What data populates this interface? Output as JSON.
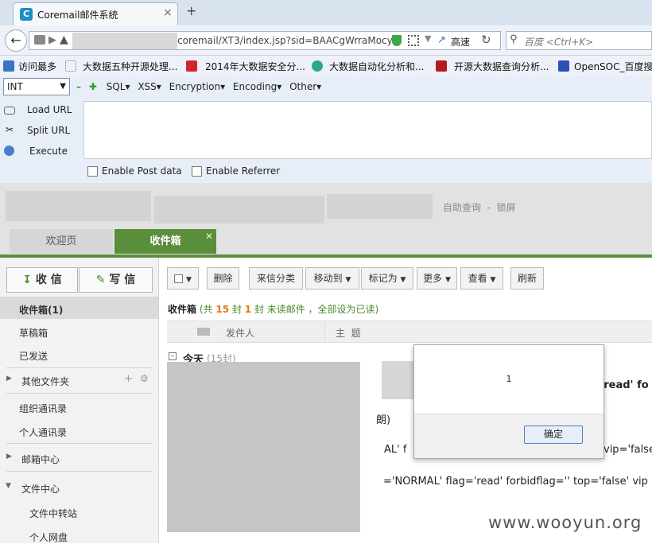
{
  "browser": {
    "tab_title": "Coremail邮件系统",
    "tab_icon_letter": "C",
    "url_visible": "coremail/XT3/index.jsp?sid=BAACgWrraMocy",
    "speed_label": "高速",
    "search_placeholder": "百度 <Ctrl+K>",
    "new_tab": "+",
    "close_tab": "×"
  },
  "bookmarks": [
    {
      "label": "访问最多"
    },
    {
      "label": "大数据五种开源处理..."
    },
    {
      "label": "2014年大数据安全分..."
    },
    {
      "label": "大数据自动化分析和..."
    },
    {
      "label": "开源大数据查询分析..."
    },
    {
      "label": "OpenSOC_百度搜"
    }
  ],
  "hackbar": {
    "select_value": "INT",
    "menus": [
      "SQL▾",
      "XSS▾",
      "Encryption▾",
      "Encoding▾",
      "Other▾"
    ],
    "load_url": "Load URL",
    "split_url": "Split URL",
    "execute": "Execute",
    "enable_post": "Enable Post data",
    "enable_referrer": "Enable Referrer"
  },
  "coremail": {
    "header_links": "自助查询  -  锁屏",
    "tab_welcome": "欢迎页",
    "tab_inbox": "收件箱",
    "receive_btn": "收 信",
    "write_btn": "写 信",
    "folders": {
      "inbox": "收件箱(1)",
      "drafts": "草稿箱",
      "sent": "已发送",
      "other": "其他文件夹",
      "org_contacts": "组织通讯录",
      "personal_contacts": "个人通讯录",
      "mail_center": "邮箱中心",
      "file_center": "文件中心",
      "file_transfer": "文件中转站",
      "personal_disk": "个人网盘"
    },
    "toolbar": {
      "delete": "删除",
      "classify": "来信分类",
      "move_to": "移动到",
      "mark_as": "标记为",
      "more": "更多",
      "view": "查看",
      "refresh": "刷新"
    },
    "summary": {
      "folder": "收件箱",
      "prefix": "(共",
      "total": "15",
      "mid": "封",
      "unread": "1",
      "suffix": "封 未读邮件 ，全部设为已读)"
    },
    "columns": {
      "sender": "发件人",
      "subject": "主  题"
    },
    "group_today": "今天",
    "group_count": "(15封)",
    "leak_1": "nread' fo",
    "leak_2": "朗)",
    "leak_3": "AL' f",
    "leak_4": "vip='false",
    "leak_5": "='NORMAL' flag='read' forbidflag='' top='false' vip"
  },
  "dialog": {
    "message": "1",
    "ok": "确定"
  },
  "watermark": "www.wooyun.org"
}
